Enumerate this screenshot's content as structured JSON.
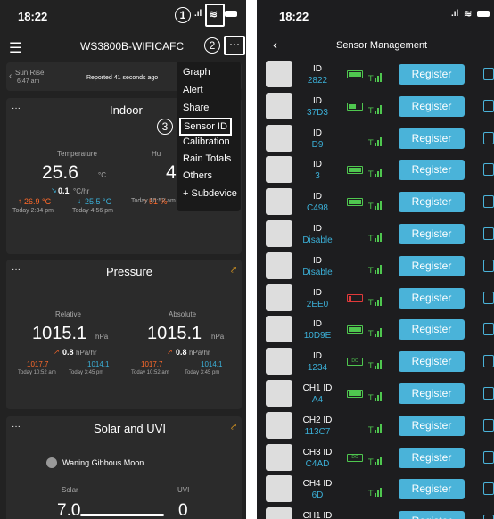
{
  "left": {
    "time": "18:22",
    "title": "WS3800B-WIFICAFC",
    "markers": [
      "1",
      "2",
      "3"
    ],
    "sunrise": {
      "label": "Sun Rise",
      "time": "6:47 am",
      "reported": "Reported 41 seconds ago"
    },
    "menu": [
      "Graph",
      "Alert",
      "Share",
      "Sensor ID",
      "Calibration",
      "Rain Totals",
      "Others",
      "+ Subdevice"
    ],
    "indoor": {
      "title": "Indoor",
      "temp_label": "Temperature",
      "temp_value": "25.6",
      "temp_unit": "°C",
      "rate_value": "0.1",
      "rate_unit": "°C/hr",
      "max": "26.9 °C",
      "min": "25.5 °C",
      "max_time": "Today 2:34 pm",
      "min_time": "Today 4:56 pm",
      "hum_label": "Hu",
      "hum_value": "4",
      "hum_max": "51 %",
      "hum_time": "Today 10:52 am"
    },
    "pressure": {
      "title": "Pressure",
      "relative_label": "Relative",
      "absolute_label": "Absolute",
      "rel_value": "1015.1",
      "abs_value": "1015.1",
      "unit": "hPa",
      "rel_rate": "0.8",
      "abs_rate": "0.8",
      "rate_unit": "hPa/hr",
      "rel_max": "1017.7",
      "rel_min": "1014.1",
      "abs_max": "1017.7",
      "abs_min": "1014.1",
      "rel_max_time": "Today 10:52 am",
      "rel_min_time": "Today 3:45 pm",
      "abs_max_time": "Today 10:52 am",
      "abs_min_time": "Today 3:45 pm"
    },
    "solar": {
      "title": "Solar and UVI",
      "moon": "Waning Gibbous Moon",
      "solar_label": "Solar",
      "uvi_label": "UVI",
      "solar_value": "7.0",
      "uvi_value": "0"
    }
  },
  "right": {
    "time": "18:22",
    "title": "Sensor Management",
    "register_label": "Register",
    "rows": [
      {
        "label": "ID",
        "value": "2822",
        "battery": "full"
      },
      {
        "label": "ID",
        "value": "37D3",
        "battery": "half"
      },
      {
        "label": "ID",
        "value": "D9",
        "battery": "none"
      },
      {
        "label": "ID",
        "value": "3",
        "battery": "full"
      },
      {
        "label": "ID",
        "value": "C498",
        "battery": "full"
      },
      {
        "label": "ID",
        "value": "Disable",
        "battery": "none"
      },
      {
        "label": "ID",
        "value": "Disable",
        "battery": "none"
      },
      {
        "label": "ID",
        "value": "2EE0",
        "battery": "low"
      },
      {
        "label": "ID",
        "value": "10D9E",
        "battery": "full"
      },
      {
        "label": "ID",
        "value": "1234",
        "battery": "dc"
      },
      {
        "label": "CH1 ID",
        "value": "A4",
        "battery": "full"
      },
      {
        "label": "CH2 ID",
        "value": "113C7",
        "battery": "none"
      },
      {
        "label": "CH3 ID",
        "value": "C4AD",
        "battery": "dc"
      },
      {
        "label": "CH4 ID",
        "value": "6D",
        "battery": "none"
      },
      {
        "label": "CH1 ID",
        "value": "",
        "battery": "none"
      }
    ]
  }
}
